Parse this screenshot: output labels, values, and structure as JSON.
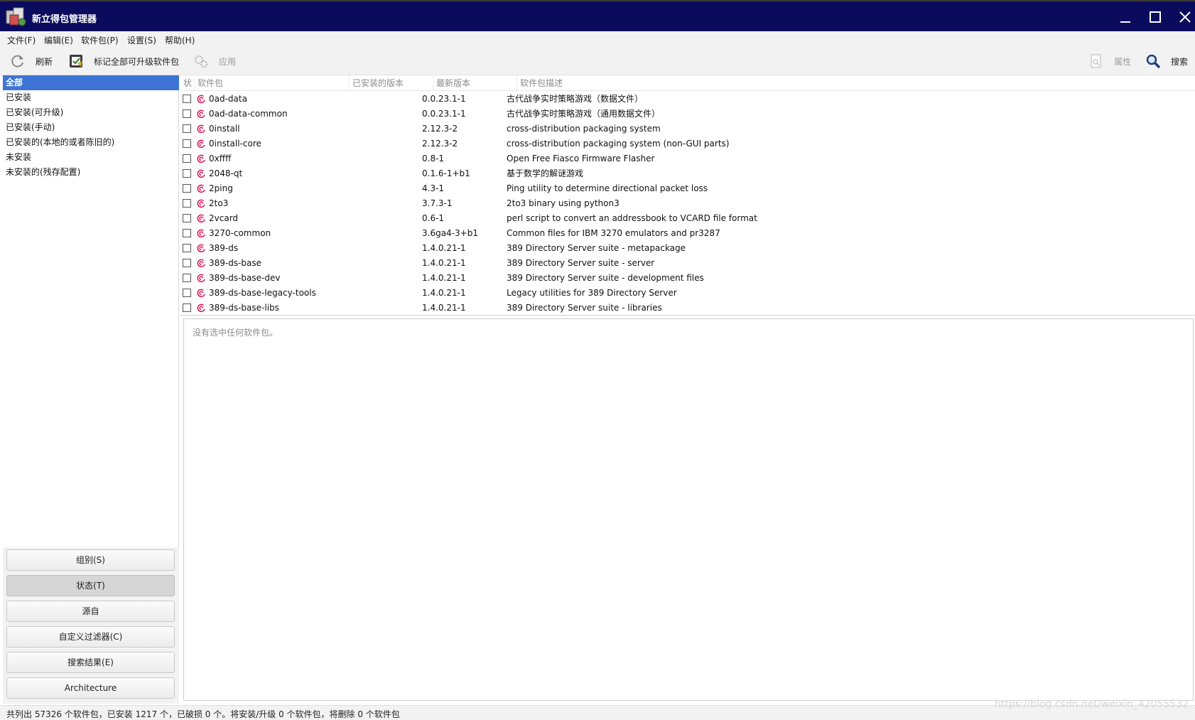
{
  "window": {
    "title": "新立得包管理器",
    "icon": "synaptic-box-icon"
  },
  "menubar": {
    "items": [
      "文件(F)",
      "编辑(E)",
      "软件包(P)",
      "设置(S)",
      "帮助(H)"
    ]
  },
  "toolbar": {
    "refresh_label": "刷新",
    "mark_all_label": "标记全部可升级软件包",
    "apply_label": "应用",
    "properties_label": "属性",
    "search_label": "搜索"
  },
  "sidebar": {
    "filters": [
      {
        "label": "全部",
        "selected": true
      },
      {
        "label": "已安装",
        "selected": false
      },
      {
        "label": "已安装(可升级)",
        "selected": false
      },
      {
        "label": "已安装(手动)",
        "selected": false
      },
      {
        "label": "已安装的(本地的或者陈旧的)",
        "selected": false
      },
      {
        "label": "未安装",
        "selected": false
      },
      {
        "label": "未安装的(残存配置)",
        "selected": false
      }
    ],
    "buttons": [
      {
        "label": "组别(S)",
        "active": false
      },
      {
        "label": "状态(T)",
        "active": true
      },
      {
        "label": "源自",
        "active": false
      },
      {
        "label": "自定义过滤器(C)",
        "active": false
      },
      {
        "label": "搜索结果(E)",
        "active": false
      },
      {
        "label": "Architecture",
        "active": false
      }
    ]
  },
  "table": {
    "headers": {
      "status": "状",
      "package": "软件包",
      "installed_version": "已安装的版本",
      "latest_version": "最新版本",
      "description": "软件包描述"
    },
    "rows": [
      {
        "package": "0ad-data",
        "installed": "",
        "latest": "0.0.23.1-1",
        "description": "古代战争实时策略游戏（数据文件）"
      },
      {
        "package": "0ad-data-common",
        "installed": "",
        "latest": "0.0.23.1-1",
        "description": "古代战争实时策略游戏（通用数据文件）"
      },
      {
        "package": "0install",
        "installed": "",
        "latest": "2.12.3-2",
        "description": "cross-distribution packaging system"
      },
      {
        "package": "0install-core",
        "installed": "",
        "latest": "2.12.3-2",
        "description": "cross-distribution packaging system (non-GUI parts)"
      },
      {
        "package": "0xffff",
        "installed": "",
        "latest": "0.8-1",
        "description": "Open Free Fiasco Firmware Flasher"
      },
      {
        "package": "2048-qt",
        "installed": "",
        "latest": "0.1.6-1+b1",
        "description": "基于数学的解谜游戏"
      },
      {
        "package": "2ping",
        "installed": "",
        "latest": "4.3-1",
        "description": "Ping utility to determine directional packet loss"
      },
      {
        "package": "2to3",
        "installed": "",
        "latest": "3.7.3-1",
        "description": "2to3 binary using python3"
      },
      {
        "package": "2vcard",
        "installed": "",
        "latest": "0.6-1",
        "description": "perl script to convert an addressbook to VCARD file format"
      },
      {
        "package": "3270-common",
        "installed": "",
        "latest": "3.6ga4-3+b1",
        "description": "Common files for IBM 3270 emulators and pr3287"
      },
      {
        "package": "389-ds",
        "installed": "",
        "latest": "1.4.0.21-1",
        "description": "389 Directory Server suite - metapackage"
      },
      {
        "package": "389-ds-base",
        "installed": "",
        "latest": "1.4.0.21-1",
        "description": "389 Directory Server suite - server"
      },
      {
        "package": "389-ds-base-dev",
        "installed": "",
        "latest": "1.4.0.21-1",
        "description": "389 Directory Server suite - development files"
      },
      {
        "package": "389-ds-base-legacy-tools",
        "installed": "",
        "latest": "1.4.0.21-1",
        "description": "Legacy utilities for 389 Directory Server"
      },
      {
        "package": "389-ds-base-libs",
        "installed": "",
        "latest": "1.4.0.21-1",
        "description": "389 Directory Server suite - libraries"
      }
    ]
  },
  "description_pane": {
    "text": "没有选中任何软件包。"
  },
  "statusbar": {
    "text": "共列出 57326 个软件包，已安装 1217 个，已破损 0 个。将安装/升级 0 个软件包，将删除 0 个软件包"
  },
  "watermark": "https://blog.csdn.net/weixin_42055532",
  "colors": {
    "titlebar": "#0b0b5e",
    "selection": "#3d74d6",
    "debian_swirl": "#d70a53"
  }
}
